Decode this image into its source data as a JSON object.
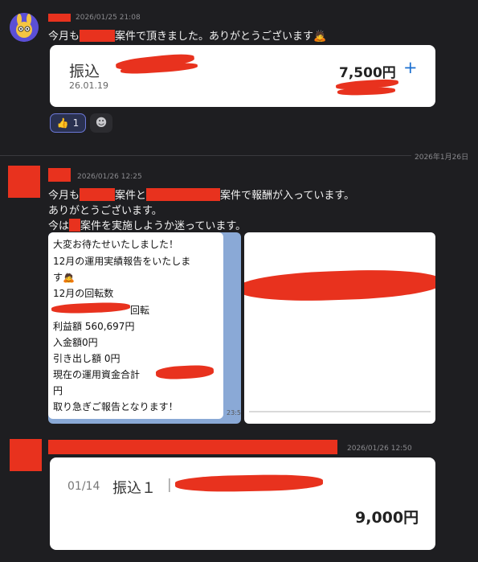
{
  "message1": {
    "timestamp": "2026/01/25 21:08",
    "text_prefix": "今月も",
    "text_suffix": "案件で頂きました。ありがとうございます",
    "emoji": "🙇",
    "card": {
      "title": "振込",
      "date": "26.01.19",
      "amount": "7,500円",
      "plus": "+"
    },
    "reactions": [
      {
        "icon": "👍",
        "count": "1"
      },
      {
        "icon": "☻"
      }
    ]
  },
  "date_divider": "2026年1月26日",
  "message2": {
    "timestamp": "2026/01/26 12:25",
    "line1_a": "今月も",
    "line1_b": "案件と",
    "line1_c": "案件で報酬が入っています。",
    "line2": "ありがとうございます。",
    "line3_a": "今は",
    "line3_b": "案件を実施しようか迷っています。",
    "screenshot_lines": [
      "大変お待たせいたしました！",
      "12月の運用実績報告をいたしま",
      "す🙇",
      "12月の回転数",
      "回転",
      "利益額 560,697円",
      "入金額0円",
      "引き出し額 0円",
      "現在の運用資金合計",
      "円",
      "取り急ぎご報告となります！"
    ],
    "screenshot_time": "23:5"
  },
  "message3": {
    "timestamp": "2026/01/26 12:50",
    "card": {
      "date": "01/14",
      "label": "振込１",
      "separator": "|",
      "amount": "9,000円"
    }
  },
  "colors": {
    "background": "#1e1e21",
    "redaction": "#e8321e",
    "accent_blue": "#1b6fd1"
  }
}
